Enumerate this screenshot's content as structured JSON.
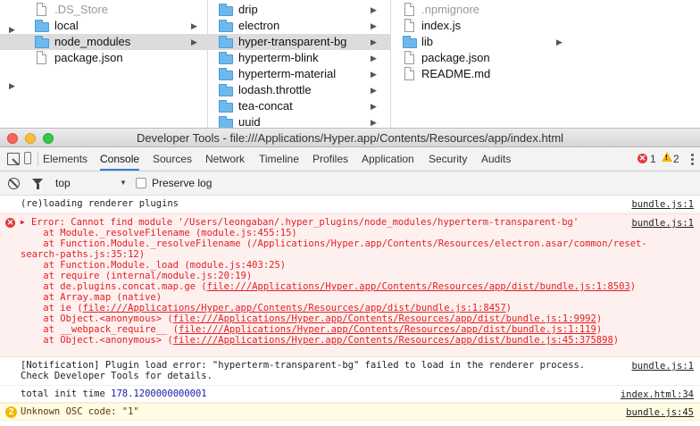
{
  "finder": {
    "col1": [
      {
        "name": ".DS_Store",
        "type": "file",
        "dim": true
      },
      {
        "name": "local",
        "type": "folder"
      },
      {
        "name": "node_modules",
        "type": "folder",
        "selected": true
      },
      {
        "name": "package.json",
        "type": "file"
      }
    ],
    "col2": [
      {
        "name": "drip",
        "type": "folder"
      },
      {
        "name": "electron",
        "type": "folder"
      },
      {
        "name": "hyper-transparent-bg",
        "type": "folder",
        "selected": true
      },
      {
        "name": "hyperterm-blink",
        "type": "folder"
      },
      {
        "name": "hyperterm-material",
        "type": "folder"
      },
      {
        "name": "lodash.throttle",
        "type": "folder"
      },
      {
        "name": "tea-concat",
        "type": "folder"
      },
      {
        "name": "uuid",
        "type": "folder"
      }
    ],
    "col3": [
      {
        "name": ".npmignore",
        "type": "file",
        "dim": true
      },
      {
        "name": "index.js",
        "type": "file"
      },
      {
        "name": "lib",
        "type": "folder"
      },
      {
        "name": "package.json",
        "type": "file"
      },
      {
        "name": "README.md",
        "type": "file"
      }
    ],
    "arrow_glyph": "▶"
  },
  "window": {
    "title": "Developer Tools - file:///Applications/Hyper.app/Contents/Resources/app/index.html"
  },
  "tabs": [
    "Elements",
    "Console",
    "Sources",
    "Network",
    "Timeline",
    "Profiles",
    "Application",
    "Security",
    "Audits"
  ],
  "active_tab": "Console",
  "counts": {
    "errors": "1",
    "warnings": "2"
  },
  "toolbar": {
    "context": "top",
    "preserve_log": "Preserve log"
  },
  "console": {
    "msg1": {
      "text": "(re)loading renderer plugins",
      "source": "bundle.js:1"
    },
    "error": {
      "lines": [
        "Error: Cannot find module '/Users/leongaban/.hyper_plugins/node_modules/hyperterm-transparent-bg'",
        "    at Module._resolveFilename (module.js:455:15)",
        "    at Function.Module._resolveFilename (/Applications/Hyper.app/Contents/Resources/electron.asar/common/reset-",
        "search-paths.js:35:12)",
        "    at Function.Module._load (module.js:403:25)",
        "    at require (internal/module.js:20:19)"
      ],
      "link_lines": [
        {
          "prefix": "    at de.plugins.concat.map.ge (",
          "link": "file:///Applications/Hyper.app/Contents/Resources/app/dist/bundle.js:1:8503",
          "suffix": ")"
        },
        {
          "prefix": "    at Array.map (native)",
          "link": "",
          "suffix": ""
        },
        {
          "prefix": "    at ie (",
          "link": "file:///Applications/Hyper.app/Contents/Resources/app/dist/bundle.js:1:8457",
          "suffix": ")"
        },
        {
          "prefix": "    at Object.<anonymous> (",
          "link": "file:///Applications/Hyper.app/Contents/Resources/app/dist/bundle.js:1:9992",
          "suffix": ")"
        },
        {
          "prefix": "    at __webpack_require__ (",
          "link": "file:///Applications/Hyper.app/Contents/Resources/app/dist/bundle.js:1:119",
          "suffix": ")"
        },
        {
          "prefix": "    at Object.<anonymous> (",
          "link": "file:///Applications/Hyper.app/Contents/Resources/app/dist/bundle.js:45:375898",
          "suffix": ")"
        }
      ],
      "source": "bundle.js:1"
    },
    "notification": {
      "line1": "[Notification] Plugin load error: \"hyperterm-transparent-bg\" failed to load in the renderer process.",
      "line2": "Check Developer Tools for details.",
      "source": "bundle.js:1"
    },
    "init": {
      "label": "total init time ",
      "value": "178.1200000000001",
      "source": "index.html:34"
    },
    "warning": {
      "text": "Unknown OSC code: \"1\"",
      "count": "2",
      "source": "bundle.js:45"
    }
  },
  "colors": {
    "accent": "#3879d9",
    "error": "#e13c3c",
    "warning": "#f2b900",
    "folder": "#6fb8ea"
  }
}
